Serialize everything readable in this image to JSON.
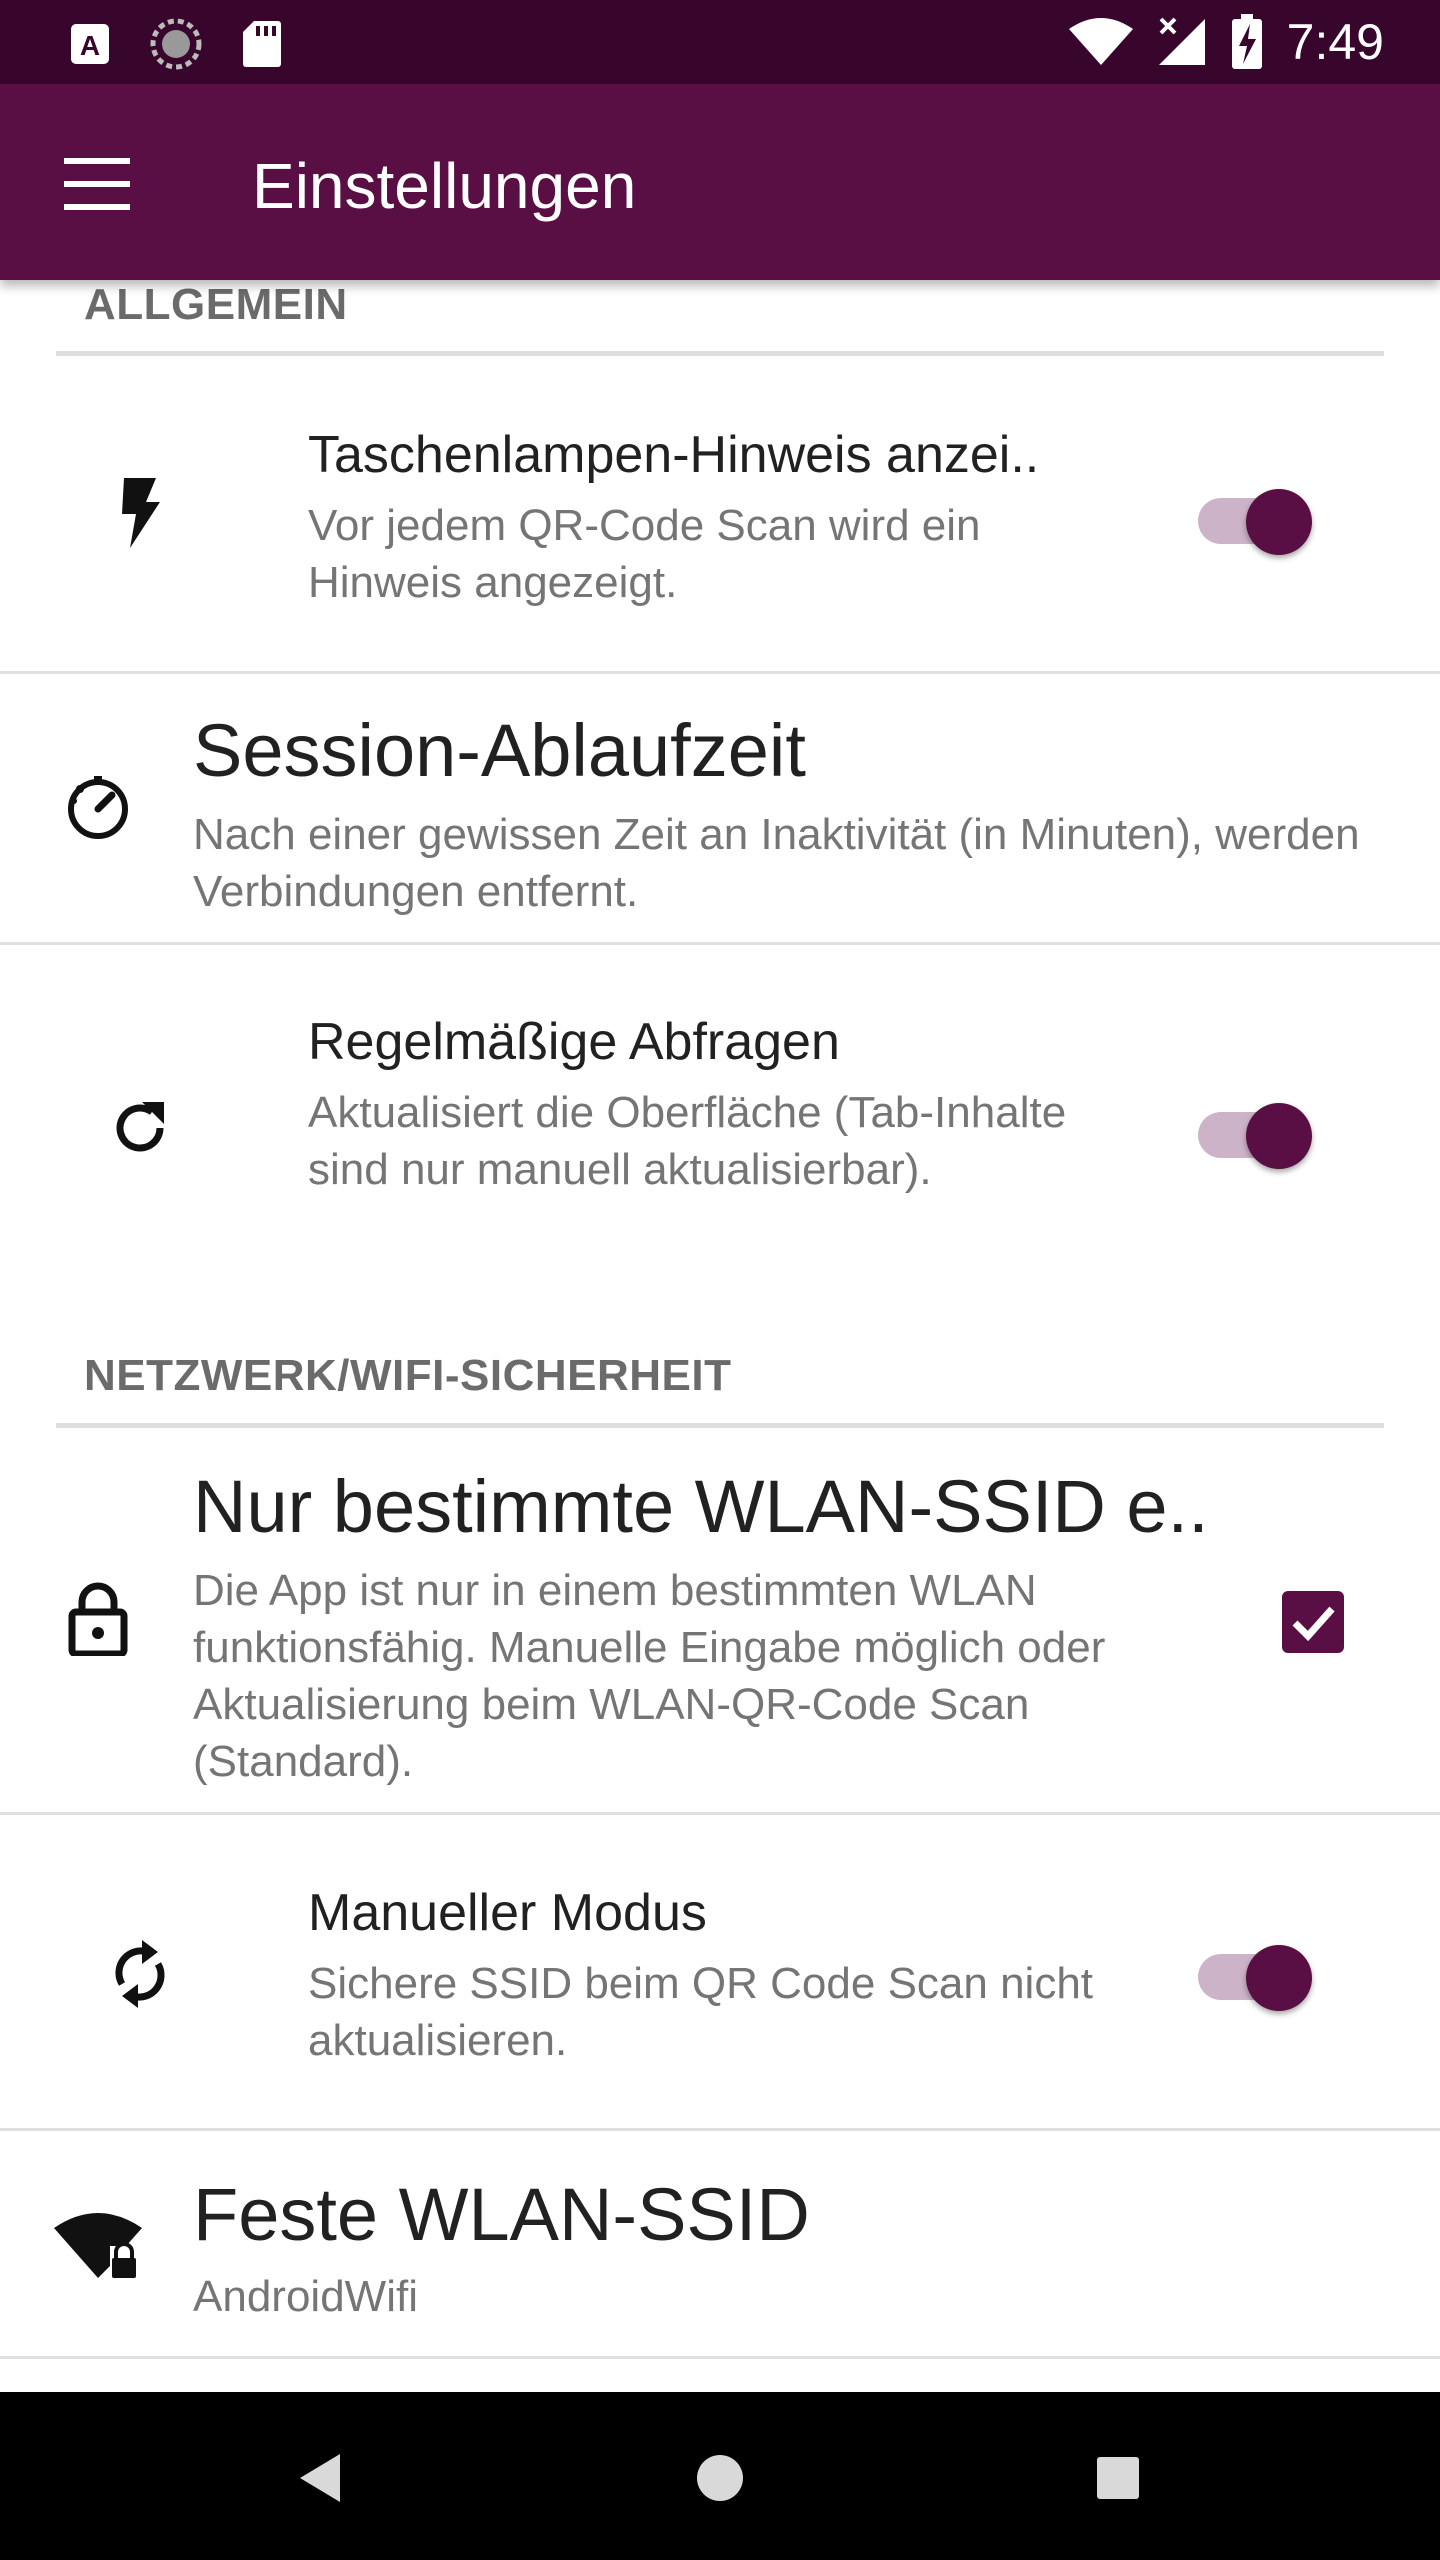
{
  "status_bar": {
    "time": "7:49",
    "left_icons": [
      "a-badge-icon",
      "sync-circle-icon",
      "sd-card-icon"
    ],
    "right_icons": [
      "wifi-icon",
      "cellular-no-signal-icon",
      "battery-charging-icon"
    ]
  },
  "app_bar": {
    "title": "Einstellungen",
    "menu_icon": "hamburger-menu-icon"
  },
  "sections": [
    {
      "header": "ALLGEMEIN",
      "items": [
        {
          "title": "Taschenlampen-Hinweis anzei..",
          "summary": "Vor jedem QR-Code Scan wird ein Hinweis angezeigt.",
          "icon": "flash-icon",
          "control": "switch",
          "checked": true
        },
        {
          "title": "Session-Ablaufzeit",
          "summary": "Nach einer gewissen Zeit an Inaktivität (in Minuten), werden Verbindungen entfernt.",
          "icon": "timer-icon",
          "control": "none"
        },
        {
          "title": "Regelmäßige Abfragen",
          "summary": "Aktualisiert die Oberfläche (Tab-Inhalte sind nur manuell aktualisierbar).",
          "icon": "refresh-icon",
          "control": "switch",
          "checked": true
        }
      ]
    },
    {
      "header": "NETZWERK/WIFI-SICHERHEIT",
      "items": [
        {
          "title": "Nur bestimmte WLAN-SSID e..",
          "summary": "Die App ist nur in einem bestimmten WLAN funktionsfähig. Manuelle Eingabe möglich oder Aktualisierung beim WLAN-QR-Code Scan (Standard).",
          "icon": "lock-icon",
          "control": "checkbox",
          "checked": true
        },
        {
          "title": "Manueller Modus",
          "summary": "Sichere SSID beim QR Code Scan nicht aktualisieren.",
          "icon": "sync-icon",
          "control": "switch",
          "checked": true
        },
        {
          "title": "Feste WLAN-SSID",
          "summary": "AndroidWifi",
          "icon": "wifi-lock-icon",
          "control": "none"
        }
      ]
    }
  ],
  "colors": {
    "status_bar": "#38062c",
    "app_bar": "#5a0f44",
    "accent": "#5a0f44",
    "switch_track": "#cdb3c7",
    "nav_bar": "#000000"
  },
  "nav_bar": {
    "icons": [
      "back-icon",
      "home-icon",
      "recents-icon"
    ]
  }
}
